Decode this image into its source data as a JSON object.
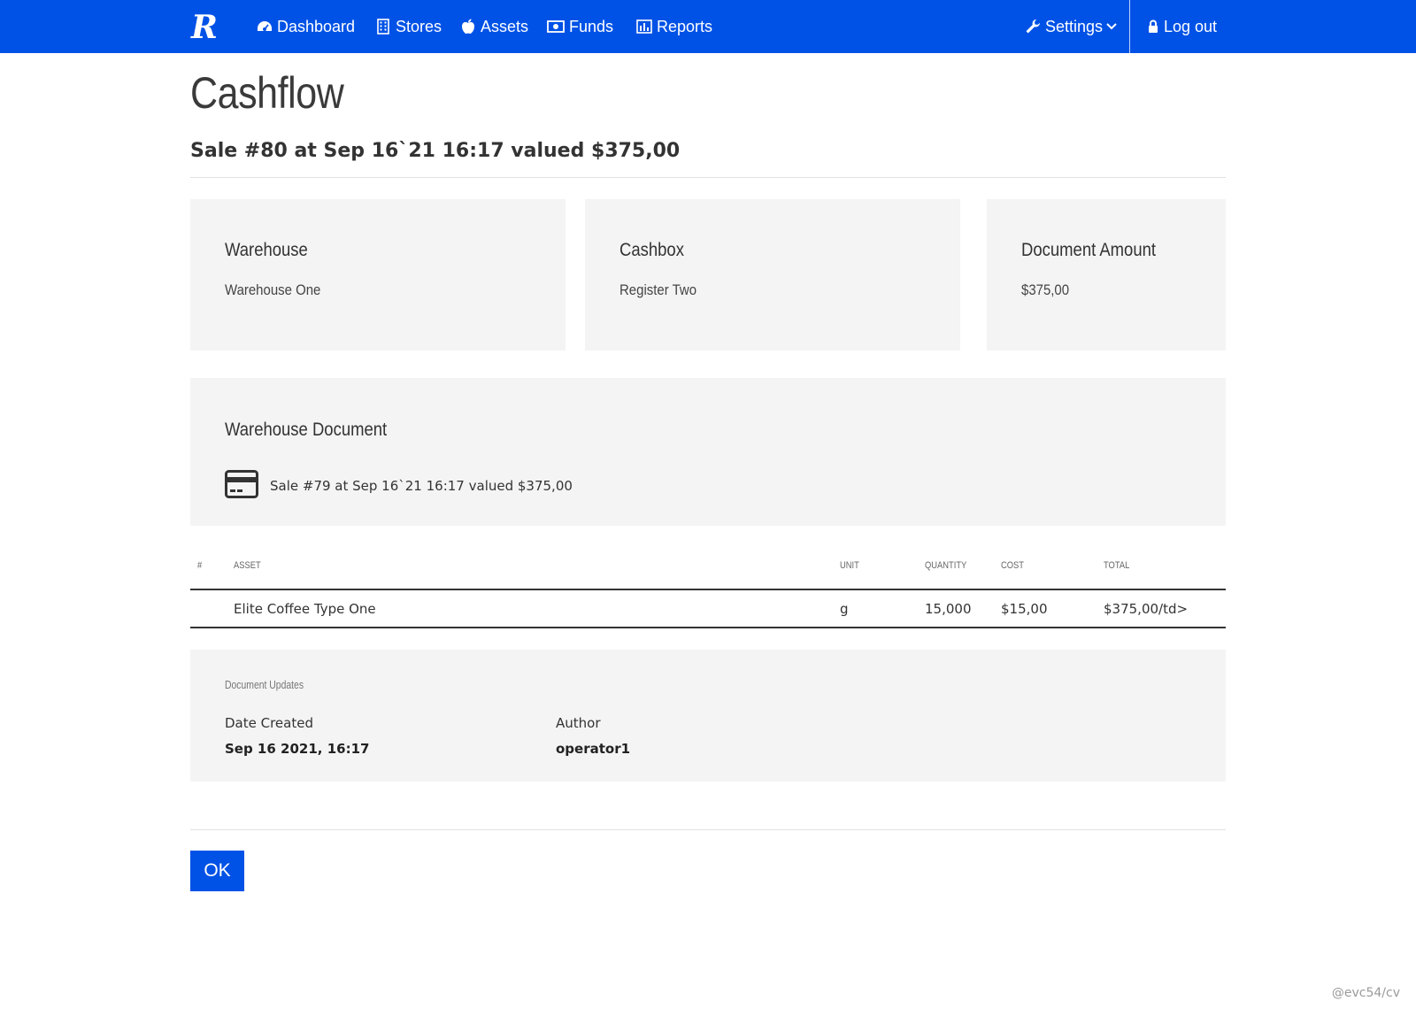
{
  "navbar": {
    "brand_letter": "R",
    "items": [
      {
        "label": "Dashboard",
        "icon": "tachometer-icon"
      },
      {
        "label": "Stores",
        "icon": "building-icon"
      },
      {
        "label": "Assets",
        "icon": "apple-icon"
      },
      {
        "label": "Funds",
        "icon": "money-icon"
      },
      {
        "label": "Reports",
        "icon": "bar-chart-icon"
      }
    ],
    "settings_label": "Settings",
    "logout_label": "Log out",
    "background_color": "#0052e6"
  },
  "page": {
    "title": "Cashflow",
    "subtitle": "Sale #80 at Sep 16`21 16:17 valued $375,00"
  },
  "cards": {
    "warehouse": {
      "title": "Warehouse",
      "value": "Warehouse One"
    },
    "cashbox": {
      "title": "Cashbox",
      "value": "Register Two"
    },
    "amount": {
      "title": "Document Amount",
      "value": "$375,00"
    }
  },
  "warehouse_document": {
    "title": "Warehouse Document",
    "link_text": "Sale #79 at Sep 16`21 16:17 valued $375,00",
    "icon": "credit-card-icon"
  },
  "table": {
    "headers": {
      "num": "#",
      "asset": "Asset",
      "unit": "Unit",
      "quantity": "Quantity",
      "cost": "Cost",
      "total": "Total"
    },
    "rows": [
      {
        "num": "",
        "asset": "Elite Coffee Type One",
        "unit": "g",
        "quantity": "15,000",
        "cost": "$15,00",
        "total": "$375,00/td>"
      }
    ]
  },
  "updates": {
    "label": "Document Updates",
    "date_created_label": "Date Created",
    "date_created_value": "Sep 16 2021, 16:17",
    "author_label": "Author",
    "author_value": "operator1"
  },
  "ok_label": "OK",
  "watermark": "@evc54/cv"
}
